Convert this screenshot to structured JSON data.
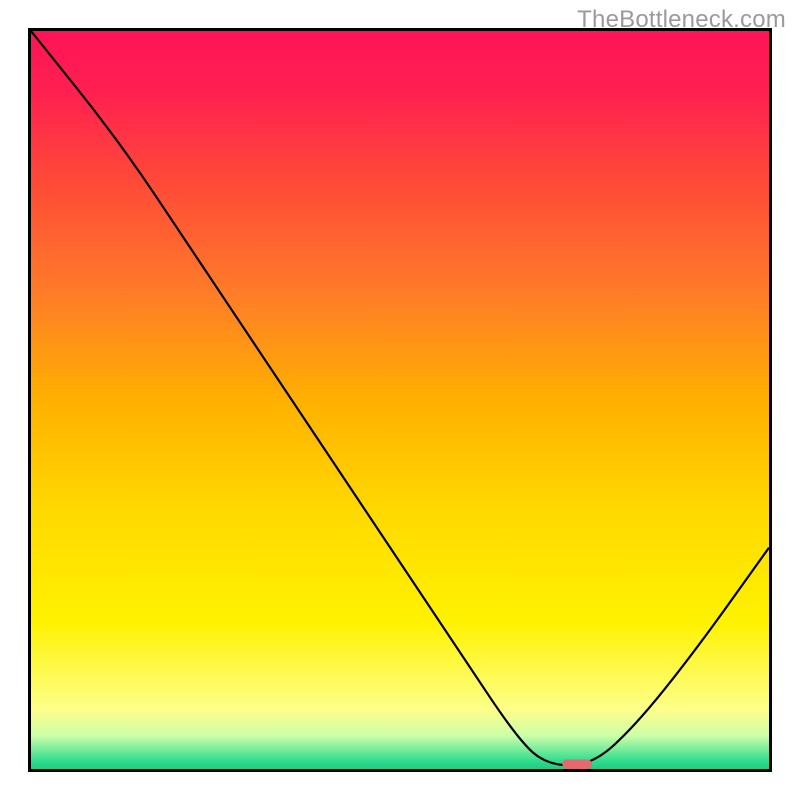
{
  "watermark": "TheBottleneck.com",
  "chart_data": {
    "type": "line",
    "title": "",
    "xlabel": "",
    "ylabel": "",
    "xlim": [
      0,
      100
    ],
    "ylim": [
      0,
      100
    ],
    "grid": false,
    "background_gradient": {
      "type": "linear-vertical",
      "stops": [
        {
          "offset": 0.0,
          "color": "#ff1456"
        },
        {
          "offset": 0.08,
          "color": "#ff1f51"
        },
        {
          "offset": 0.2,
          "color": "#ff4838"
        },
        {
          "offset": 0.35,
          "color": "#ff7a29"
        },
        {
          "offset": 0.5,
          "color": "#ffb000"
        },
        {
          "offset": 0.65,
          "color": "#ffd900"
        },
        {
          "offset": 0.8,
          "color": "#fff200"
        },
        {
          "offset": 0.92,
          "color": "#fdff8a"
        },
        {
          "offset": 0.955,
          "color": "#ccffa8"
        },
        {
          "offset": 0.99,
          "color": "#2cdc8e"
        },
        {
          "offset": 1.0,
          "color": "#23c97f"
        }
      ]
    },
    "series": [
      {
        "name": "bottleneck-curve",
        "stroke": "#000000",
        "stroke_width": 2,
        "points": [
          {
            "x": 0,
            "y": 100
          },
          {
            "x": 12,
            "y": 85
          },
          {
            "x": 22,
            "y": 70
          },
          {
            "x": 34,
            "y": 52
          },
          {
            "x": 46,
            "y": 34
          },
          {
            "x": 58,
            "y": 16
          },
          {
            "x": 66,
            "y": 4
          },
          {
            "x": 70,
            "y": 0.5
          },
          {
            "x": 76,
            "y": 0.5
          },
          {
            "x": 82,
            "y": 6
          },
          {
            "x": 90,
            "y": 16
          },
          {
            "x": 100,
            "y": 30
          }
        ]
      }
    ],
    "marker": {
      "name": "optimal-point",
      "x": 74,
      "y": 0,
      "width": 4,
      "height": 1.3,
      "color": "#e46a6f"
    }
  }
}
